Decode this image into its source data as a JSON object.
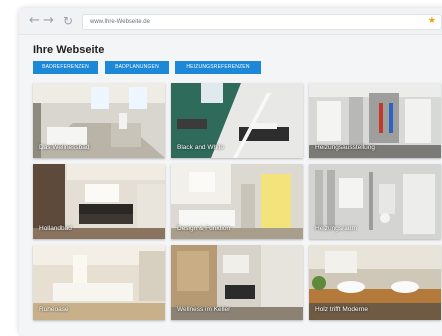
{
  "browser": {
    "url": "www.Ihre-Webseite.de",
    "back_icon": "arrow-left",
    "forward_icon": "arrow-right",
    "reload_icon": "reload",
    "bookmark_icon": "star"
  },
  "page": {
    "title": "Ihre Webseite",
    "buttons": [
      "BADREFERENZEN",
      "BADPLANUNGEN",
      "HEIZUNGSREFERENZEN"
    ],
    "accent_color": "#1e88d8"
  },
  "gallery": [
    {
      "caption": "Das Wellnessbad"
    },
    {
      "caption": "Black and White"
    },
    {
      "caption": "Heizungsausstellung"
    },
    {
      "caption": "Hollandbad"
    },
    {
      "caption": "Design & Funktion"
    },
    {
      "caption": "Heizungsraum"
    },
    {
      "caption": "Ruheoase"
    },
    {
      "caption": "Wellness im Keller"
    },
    {
      "caption": "Holz trifft Moderne"
    }
  ]
}
